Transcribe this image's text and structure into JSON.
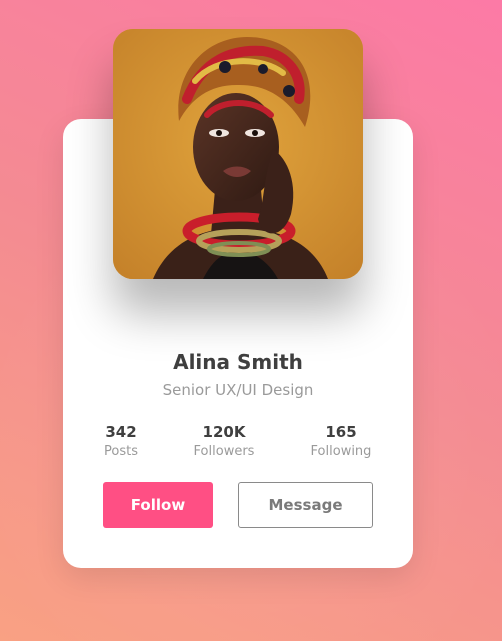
{
  "profile": {
    "name": "Alina Smith",
    "role": "Senior UX/UI Design"
  },
  "stats": [
    {
      "value": "342",
      "label": "Posts"
    },
    {
      "value": "120K",
      "label": "Followers"
    },
    {
      "value": "165",
      "label": "Following"
    }
  ],
  "actions": {
    "follow_label": "Follow",
    "message_label": "Message"
  },
  "colors": {
    "accent": "#ff4f84",
    "text_dark": "#3f3f3f",
    "text_muted": "#9a9a9a"
  }
}
